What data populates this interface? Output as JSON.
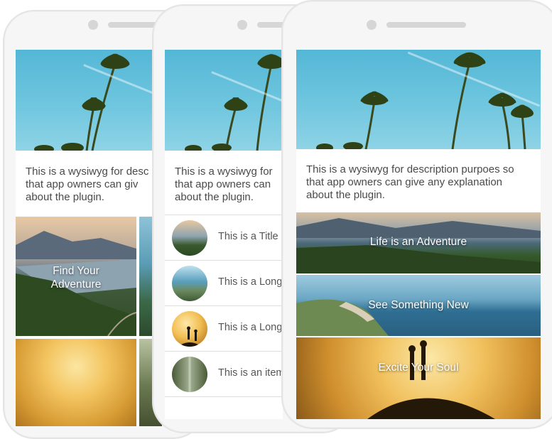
{
  "screens": {
    "left": {
      "description_lines": [
        "This is a wysiwyg for desc",
        "that app owners can giv",
        "about the plugin."
      ],
      "tiles": [
        {
          "label_lines": [
            "Find Your",
            "Adventure"
          ]
        }
      ]
    },
    "middle": {
      "description_lines": [
        "This is a wysiwyg for",
        "that app owners can",
        "about the plugin."
      ],
      "list_items": [
        {
          "title": "This is a Title",
          "thumb_icon": "lake-landscape-icon"
        },
        {
          "title": "This is a Long",
          "thumb_icon": "coastline-icon"
        },
        {
          "title": "This is a Long",
          "thumb_icon": "hikers-sunset-icon"
        },
        {
          "title": "This is an item",
          "thumb_icon": "forest-road-icon"
        }
      ]
    },
    "right": {
      "description_lines": [
        "This is a wysiwyg for description purpoes so",
        "that app owners can give any explanation",
        "about the plugin."
      ],
      "tiles": [
        {
          "label": "Life is an Adventure"
        },
        {
          "label": "See Something New"
        },
        {
          "label": "Excite Your Soul"
        }
      ]
    }
  },
  "colors": {
    "sky": "#5fbfdb",
    "text": "#4a4a4a",
    "phone_frame": "#f6f6f6",
    "divider": "#dedede"
  }
}
